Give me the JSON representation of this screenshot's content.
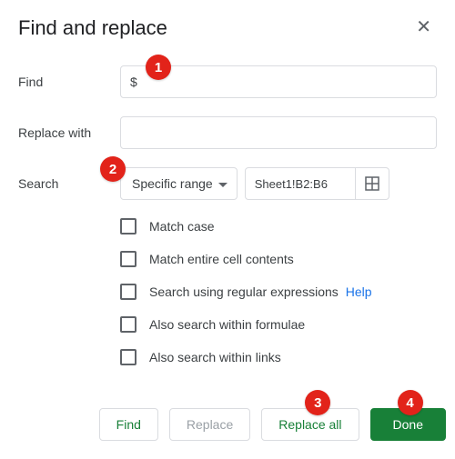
{
  "dialog": {
    "title": "Find and replace",
    "find_label": "Find",
    "find_value": "$",
    "replace_label": "Replace with",
    "replace_value": "",
    "search_label": "Search",
    "search_scope": "Specific range",
    "range_value": "Sheet1!B2:B6"
  },
  "options": [
    {
      "label": "Match case"
    },
    {
      "label": "Match entire cell contents"
    },
    {
      "label": "Search using regular expressions",
      "help": "Help"
    },
    {
      "label": "Also search within formulae"
    },
    {
      "label": "Also search within links"
    }
  ],
  "buttons": {
    "find": "Find",
    "replace": "Replace",
    "replace_all": "Replace all",
    "done": "Done"
  },
  "badges": [
    "1",
    "2",
    "3",
    "4"
  ]
}
